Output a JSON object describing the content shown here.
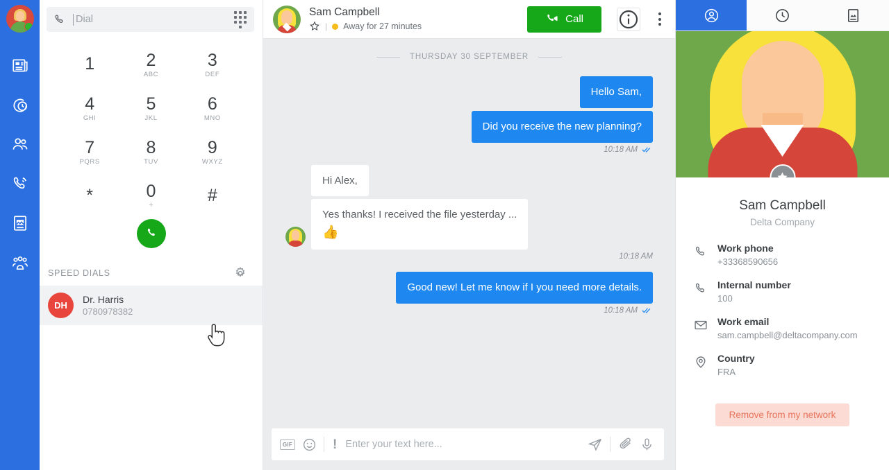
{
  "rail": {
    "avatar_name": "user-avatar",
    "items": [
      {
        "icon": "news-feed-icon",
        "name": "sidebar-item-feed"
      },
      {
        "icon": "history-icon",
        "name": "sidebar-item-history"
      },
      {
        "icon": "contacts-icon",
        "name": "sidebar-item-contacts"
      },
      {
        "icon": "phone-icon",
        "name": "sidebar-item-calls"
      },
      {
        "icon": "media-document-icon",
        "name": "sidebar-item-documents"
      },
      {
        "icon": "group-icon",
        "name": "sidebar-item-groups"
      }
    ]
  },
  "dialer": {
    "placeholder": "Dial",
    "value": "",
    "keys": [
      {
        "digit": "1",
        "letters": ""
      },
      {
        "digit": "2",
        "letters": "ABC"
      },
      {
        "digit": "3",
        "letters": "DEF"
      },
      {
        "digit": "4",
        "letters": "GHI"
      },
      {
        "digit": "5",
        "letters": "JKL"
      },
      {
        "digit": "6",
        "letters": "MNO"
      },
      {
        "digit": "7",
        "letters": "PQRS"
      },
      {
        "digit": "8",
        "letters": "TUV"
      },
      {
        "digit": "9",
        "letters": "WXYZ"
      },
      {
        "digit": "*",
        "letters": ""
      },
      {
        "digit": "0",
        "letters": "+"
      },
      {
        "digit": "#",
        "letters": ""
      }
    ],
    "speed_dials_title": "SPEED DIALS",
    "speed_dials": [
      {
        "initials": "DH",
        "name": "Dr. Harris",
        "number": "0780978382",
        "color": "#e8453c"
      }
    ]
  },
  "chat_header": {
    "name": "Sam Campbell",
    "status_text": "Away for 27 minutes",
    "status_color": "#f5bc1b",
    "separator": "|",
    "call_label": "Call"
  },
  "conversation": {
    "day_separator": "THURSDAY 30 SEPTEMBER",
    "messages": [
      {
        "dir": "out",
        "text": "Hello Sam,",
        "time": "",
        "read": false
      },
      {
        "dir": "out",
        "text": "Did you receive the new planning?",
        "time": "10:18 AM",
        "read": true
      },
      {
        "dir": "in",
        "text": "Hi Alex,",
        "time": "",
        "read": false
      },
      {
        "dir": "in",
        "text": "Yes thanks! I received the file yesterday ...",
        "emoji": "👍",
        "time": "10:18 AM",
        "read": false
      },
      {
        "dir": "out",
        "text": "Good new! Let me know if I you need more details.",
        "time": "10:18 AM",
        "read": true
      }
    ]
  },
  "composer": {
    "placeholder": "Enter your text here...",
    "gif_label": "GIF",
    "priority_label": "!"
  },
  "profile": {
    "tabs": [
      {
        "icon": "profile-icon",
        "name": "tab-profile",
        "active": true
      },
      {
        "icon": "clock-icon",
        "name": "tab-history",
        "active": false
      },
      {
        "icon": "media-icon",
        "name": "tab-media",
        "active": false
      }
    ],
    "name": "Sam Campbell",
    "company": "Delta Company",
    "fields": [
      {
        "icon": "phone-icon",
        "label": "Work phone",
        "value": "+33368590656"
      },
      {
        "icon": "phone-icon",
        "label": "Internal number",
        "value": "100"
      },
      {
        "icon": "mail-icon",
        "label": "Work email",
        "value": "sam.campbell@deltacompany.com"
      },
      {
        "icon": "location-pin-icon",
        "label": "Country",
        "value": "FRA"
      }
    ],
    "remove_label": "Remove from my network"
  },
  "colors": {
    "brand_blue": "#2b6fe0",
    "bubble_blue": "#1e88f0",
    "call_green": "#17a81a",
    "status_away": "#f5bc1b",
    "remove_bg": "#fbdbd3",
    "remove_text": "#e8735a"
  }
}
